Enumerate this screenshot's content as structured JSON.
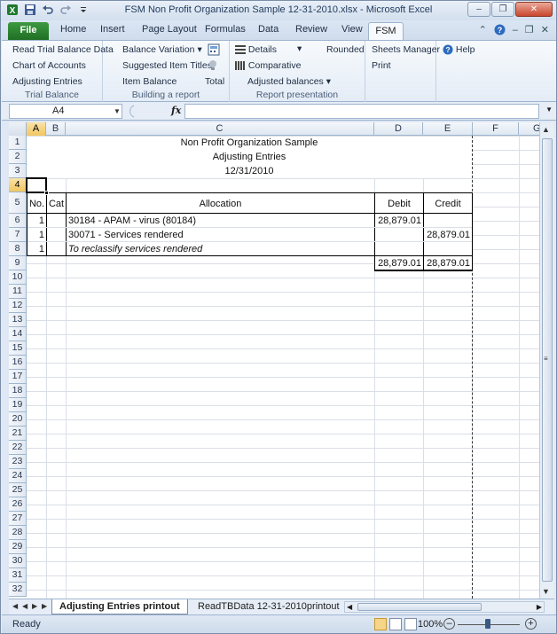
{
  "window": {
    "title": "FSM Non Profit Organization Sample 12-31-2010.xlsx - Microsoft Excel"
  },
  "tabs": [
    "File",
    "Home",
    "Insert",
    "Page Layout",
    "Formulas",
    "Data",
    "Review",
    "View",
    "FSM"
  ],
  "ribbon": {
    "group1": {
      "title": "Trial Balance",
      "items": [
        "Read Trial Balance Data",
        "Chart of Accounts",
        "Adjusting Entries"
      ]
    },
    "group2": {
      "title": "Building a report",
      "items": [
        "Balance Variation",
        "Suggested Item Titles",
        "Item Balance",
        "Total"
      ]
    },
    "group3": {
      "title": "Report presentation",
      "items": [
        "Details",
        "Rounded",
        "Comparative",
        "Adjusted balances"
      ]
    },
    "group4": {
      "items": [
        "Sheets Manager",
        "Print",
        "Help"
      ]
    }
  },
  "formula_bar": {
    "name_box": "A4",
    "fx": "fx",
    "content": ""
  },
  "columns": [
    "A",
    "B",
    "C",
    "D",
    "E",
    "F",
    "G"
  ],
  "rows": [
    "1",
    "2",
    "3",
    "4",
    "5",
    "6",
    "7",
    "8",
    "9",
    "10",
    "11",
    "12",
    "13",
    "14",
    "15",
    "16",
    "17",
    "18",
    "19",
    "20",
    "21",
    "22",
    "23",
    "24",
    "25",
    "26",
    "27",
    "28",
    "29",
    "30",
    "31",
    "32"
  ],
  "report": {
    "title": "Non Profit Organization Sample",
    "subtitle": "Adjusting Entries",
    "date": "12/31/2010",
    "headers": {
      "no": "No.",
      "cat": "Cat",
      "allocation": "Allocation",
      "debit": "Debit",
      "credit": "Credit"
    },
    "lines": [
      {
        "no": "1",
        "allocation": "30184 - APAM - virus (80184)",
        "debit": "28,879.01",
        "credit": ""
      },
      {
        "no": "1",
        "allocation": "30071 - Services rendered",
        "debit": "",
        "credit": "28,879.01"
      },
      {
        "no": "1",
        "allocation": "To reclassify services rendered",
        "debit": "",
        "credit": ""
      }
    ],
    "totals": {
      "debit": "28,879.01",
      "credit": "28,879.01"
    }
  },
  "sheet_tabs": [
    "Adjusting Entries printout",
    "ReadTBData 12-31-2010printout"
  ],
  "status": {
    "text": "Ready",
    "zoom": "100%"
  }
}
